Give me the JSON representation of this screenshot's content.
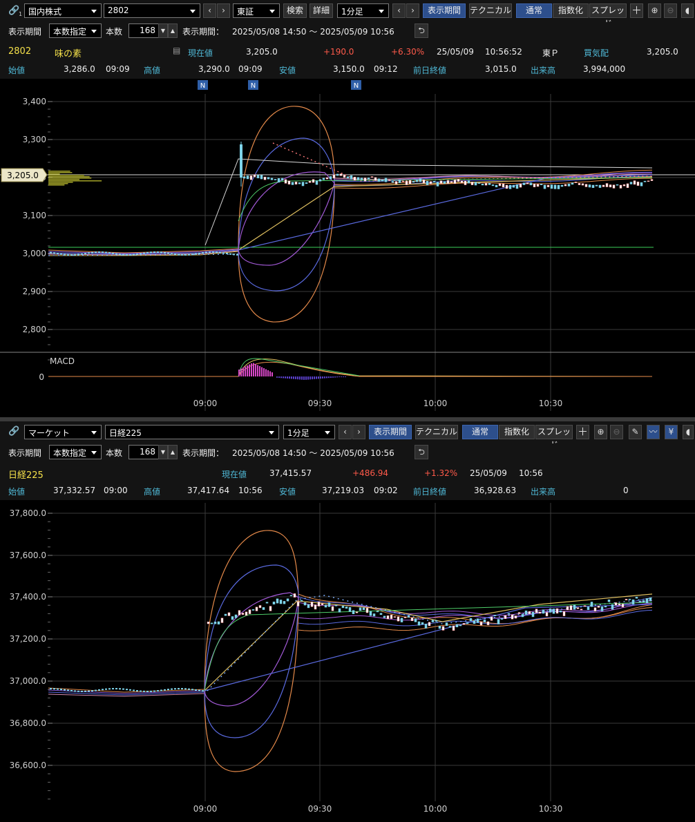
{
  "panel1": {
    "toolbar": {
      "market": "国内株式",
      "code": "2802",
      "exchange": "東証",
      "search": "検索",
      "detail": "詳細",
      "interval": "1分足",
      "view_period": "表示期間",
      "technical": "テクニカル",
      "normal": "通常",
      "index": "指数化",
      "spread": "スプレッド"
    },
    "period": {
      "label": "表示期間",
      "mode": "本数指定",
      "count_label": "本数",
      "count": "168",
      "range_label": "表示期間：",
      "range": "2025/05/08 14:50 ～ 2025/05/09 10:56"
    },
    "quote": {
      "code": "2802",
      "name": "味の素",
      "current_label": "現在値",
      "current": "3,205.0",
      "change": "+190.0",
      "change_pct": "+6.30%",
      "date": "25/05/09",
      "time": "10:56:52",
      "market": "東Ｐ",
      "bid_label": "買気配",
      "bid": "3,205.0",
      "open_label": "始値",
      "open": "3,286.0",
      "open_time": "09:09",
      "high_label": "高値",
      "high": "3,290.0",
      "high_time": "09:09",
      "low_label": "安値",
      "low": "3,150.0",
      "low_time": "09:12",
      "prev_label": "前日終値",
      "prev": "3,015.0",
      "volume_label": "出来高",
      "volume": "3,994,000"
    },
    "news_markers": [
      "N",
      "N",
      "N"
    ],
    "price_tag": "3,205.0",
    "y_ticks": [
      "3,400",
      "3,300",
      "3,200",
      "3,100",
      "3,000",
      "2,900",
      "2,800"
    ],
    "macd_label": "MACD",
    "macd_zero": "0",
    "x_ticks": [
      "09:00",
      "09:30",
      "10:00",
      "10:30"
    ]
  },
  "panel2": {
    "toolbar": {
      "market": "マーケット",
      "code": "日経225",
      "interval": "1分足",
      "view_period": "表示期間",
      "technical": "テクニカル",
      "normal": "通常",
      "index": "指数化",
      "spread": "スプレッド"
    },
    "period": {
      "label": "表示期間",
      "mode": "本数指定",
      "count_label": "本数",
      "count": "168",
      "range_label": "表示期間：",
      "range": "2025/05/08 14:50 ～ 2025/05/09 10:56"
    },
    "quote": {
      "name": "日経225",
      "current_label": "現在値",
      "current": "37,415.57",
      "change": "+486.94",
      "change_pct": "+1.32%",
      "date": "25/05/09",
      "time": "10:56",
      "open_label": "始値",
      "open": "37,332.57",
      "open_time": "09:00",
      "high_label": "高値",
      "high": "37,417.64",
      "high_time": "10:56",
      "low_label": "安値",
      "low": "37,219.03",
      "low_time": "09:02",
      "prev_label": "前日終値",
      "prev": "36,928.63",
      "volume_label": "出来高",
      "volume": "0"
    },
    "y_ticks": [
      "37,800.0",
      "37,600.0",
      "37,400.0",
      "37,200.0",
      "37,000.0",
      "36,800.0",
      "36,600.0"
    ],
    "x_ticks": [
      "09:00",
      "09:30",
      "10:00",
      "10:30"
    ]
  },
  "colors": {
    "background": "#000000",
    "accent_blue": "#2d4f8c",
    "label_cyan": "#4fb8d6",
    "name_yellow": "#f4e04a",
    "up_red": "#ff5a4a",
    "candle_cyan": "#7fd4ea",
    "candle_up": "#ff8a8a"
  }
}
